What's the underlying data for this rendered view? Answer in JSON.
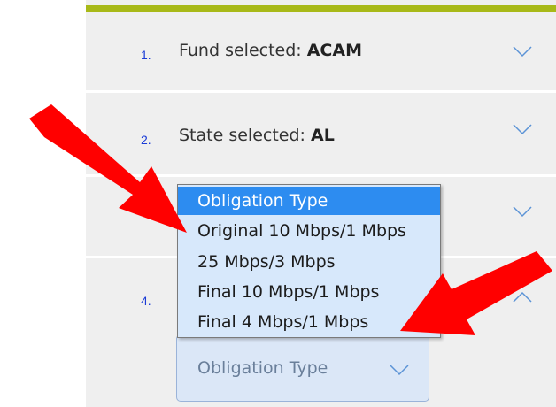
{
  "steps": [
    {
      "number": "1.",
      "label": "Fund selected: ",
      "value": "ACAM"
    },
    {
      "number": "2.",
      "label": "State selected: ",
      "value": "AL"
    },
    {
      "number": "4."
    }
  ],
  "dropdown": {
    "options": [
      "Obligation Type",
      "Original 10 Mbps/1 Mbps",
      "25 Mbps/3 Mbps",
      "Final 10 Mbps/1 Mbps",
      "Final 4 Mbps/1 Mbps"
    ],
    "highlighted_index": 0
  },
  "select": {
    "placeholder": "Obligation Type"
  },
  "colors": {
    "accent_bar": "#a8b918",
    "step_number": "#1a3bd6",
    "highlight": "#2d8cf0",
    "arrow": "#ff0000"
  },
  "icons": {
    "collapsed_chevron": "chevron-down-icon",
    "expanded_chevron": "chevron-up-icon",
    "annotation": "red-arrow"
  }
}
